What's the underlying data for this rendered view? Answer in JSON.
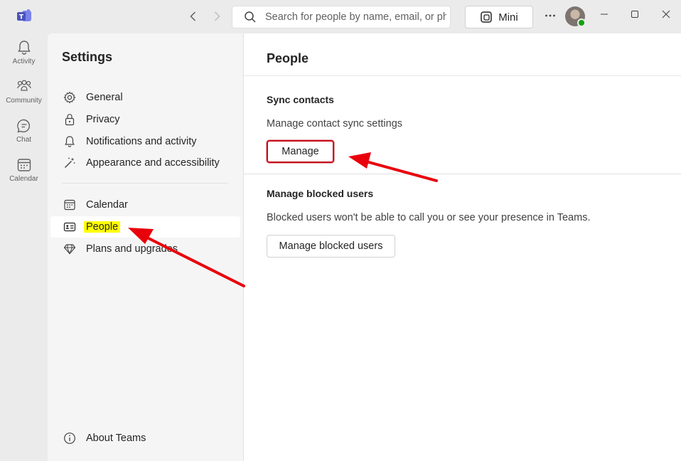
{
  "titlebar": {
    "back_icon": "chevron-left-icon",
    "forward_icon": "chevron-right-icon",
    "search_placeholder": "Search for people by name, email, or phone number",
    "mini_label": "Mini",
    "more_icon": "more-horizontal-icon"
  },
  "rail": {
    "items": [
      {
        "label": "Activity",
        "icon": "bell-icon"
      },
      {
        "label": "Community",
        "icon": "community-icon"
      },
      {
        "label": "Chat",
        "icon": "chat-icon"
      },
      {
        "label": "Calendar",
        "icon": "calendar-icon"
      }
    ]
  },
  "settings": {
    "title": "Settings",
    "items": [
      {
        "label": "General",
        "icon": "gear-icon"
      },
      {
        "label": "Privacy",
        "icon": "lock-icon"
      },
      {
        "label": "Notifications and activity",
        "icon": "bell-icon"
      },
      {
        "label": "Appearance and accessibility",
        "icon": "magic-wand-icon"
      },
      {
        "label": "Calendar",
        "icon": "calendar-icon"
      },
      {
        "label": "People",
        "icon": "contact-card-icon",
        "selected": true
      },
      {
        "label": "Plans and upgrades",
        "icon": "diamond-icon"
      }
    ],
    "about_label": "About Teams"
  },
  "content": {
    "title": "People",
    "sync": {
      "title": "Sync contacts",
      "description": "Manage contact sync settings",
      "button": "Manage"
    },
    "blocked": {
      "title": "Manage blocked users",
      "description": "Blocked users won't be able to call you or see your presence in Teams.",
      "button": "Manage blocked users"
    }
  },
  "colors": {
    "accent": "#5b5fc7",
    "highlight": "#ffff00",
    "annotation": "#e8000b",
    "presence": "#13a10e"
  }
}
